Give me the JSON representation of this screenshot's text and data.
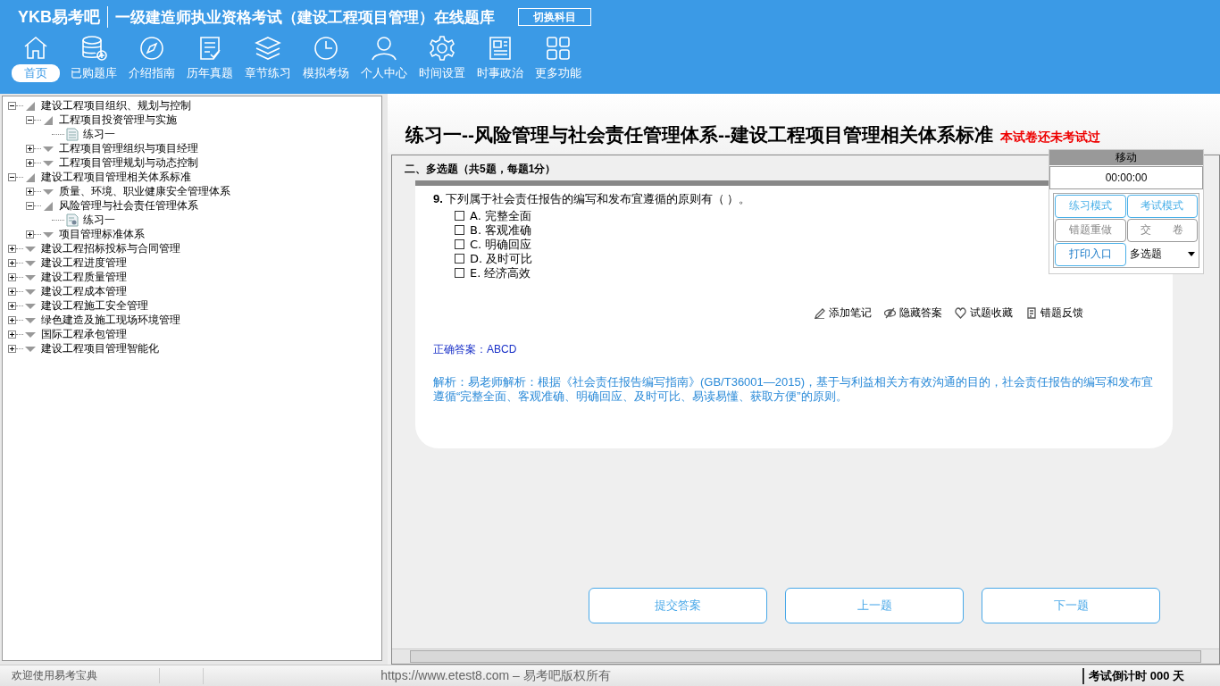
{
  "header": {
    "logo": "YKB易考吧",
    "title": "一级建造师执业资格考试（建设工程项目管理）在线题库",
    "switch_button": "切换科目"
  },
  "nav": [
    {
      "label": "首页",
      "selected": true
    },
    {
      "label": "已购题库",
      "selected": false
    },
    {
      "label": "介绍指南",
      "selected": false
    },
    {
      "label": "历年真题",
      "selected": false
    },
    {
      "label": "章节练习",
      "selected": false
    },
    {
      "label": "模拟考场",
      "selected": false
    },
    {
      "label": "个人中心",
      "selected": false
    },
    {
      "label": "时间设置",
      "selected": false
    },
    {
      "label": "时事政治",
      "selected": false
    },
    {
      "label": "更多功能",
      "selected": false
    }
  ],
  "tree": [
    {
      "label": "建设工程项目组织、规划与控制",
      "expanded": true,
      "children": [
        {
          "label": "工程项目投资管理与实施",
          "expanded": true,
          "children": [
            {
              "label": "练习一",
              "kind": "exercise"
            }
          ]
        },
        {
          "label": "工程项目管理组织与项目经理",
          "expanded": false
        },
        {
          "label": "工程项目管理规划与动态控制",
          "expanded": false
        }
      ]
    },
    {
      "label": "建设工程项目管理相关体系标准",
      "expanded": true,
      "children": [
        {
          "label": "质量、环境、职业健康安全管理体系",
          "expanded": false
        },
        {
          "label": "风险管理与社会责任管理体系",
          "expanded": true,
          "children": [
            {
              "label": "练习一",
              "kind": "current"
            }
          ]
        },
        {
          "label": "项目管理标准体系",
          "expanded": false
        }
      ]
    },
    {
      "label": "建设工程招标投标与合同管理",
      "expanded": false
    },
    {
      "label": "建设工程进度管理",
      "expanded": false
    },
    {
      "label": "建设工程质量管理",
      "expanded": false
    },
    {
      "label": "建设工程成本管理",
      "expanded": false
    },
    {
      "label": "建设工程施工安全管理",
      "expanded": false
    },
    {
      "label": "绿色建造及施工现场环境管理",
      "expanded": false
    },
    {
      "label": "国际工程承包管理",
      "expanded": false
    },
    {
      "label": "建设工程项目管理智能化",
      "expanded": false
    }
  ],
  "exam": {
    "title": "练习一--风险管理与社会责任管理体系--建设工程项目管理相关体系标准",
    "status": "本试卷还未考试过",
    "section": "二、多选题（共5题，每题1分）",
    "question": {
      "number": "9.",
      "text": "下列属于社会责任报告的编写和发布宜遵循的原则有（ ）。",
      "options": [
        {
          "label": "A. 完整全面",
          "checked": false
        },
        {
          "label": "B. 客观准确",
          "checked": false
        },
        {
          "label": "C. 明确回应",
          "checked": false
        },
        {
          "label": "D. 及时可比",
          "checked": false
        },
        {
          "label": "E. 经济高效",
          "checked": false
        }
      ]
    },
    "tools": [
      "添加笔记",
      "隐藏答案",
      "试题收藏",
      "错题反馈"
    ],
    "answer": "正确答案：ABCD",
    "analysis": "解析：易老师解析：根据《社会责任报告编写指南》(GB/T36001—2015)，基于与利益相关方有效沟通的目的，社会责任报告的编写和发布宜遵循“完整全面、客观准确、明确回应、及时可比、易读易懂、获取方便”的原则。",
    "buttons": [
      "提交答案",
      "上一题",
      "下一题"
    ]
  },
  "panel": {
    "title": "移动",
    "timer": "00:00:00",
    "buttons": [
      {
        "label": "练习模式",
        "kind": "mode"
      },
      {
        "label": "考试模式",
        "kind": "mode"
      },
      {
        "label": "错题重做",
        "kind": "plain"
      },
      {
        "label": "交　　卷",
        "kind": "plain"
      },
      {
        "label": "打印入口",
        "kind": "mode"
      }
    ],
    "dropdown": "多选题"
  },
  "status_bar": {
    "welcome": "欢迎使用易考宝典",
    "copyright": "https://www.etest8.com – 易考吧版权所有",
    "countdown": "考试倒计时 000 天"
  }
}
